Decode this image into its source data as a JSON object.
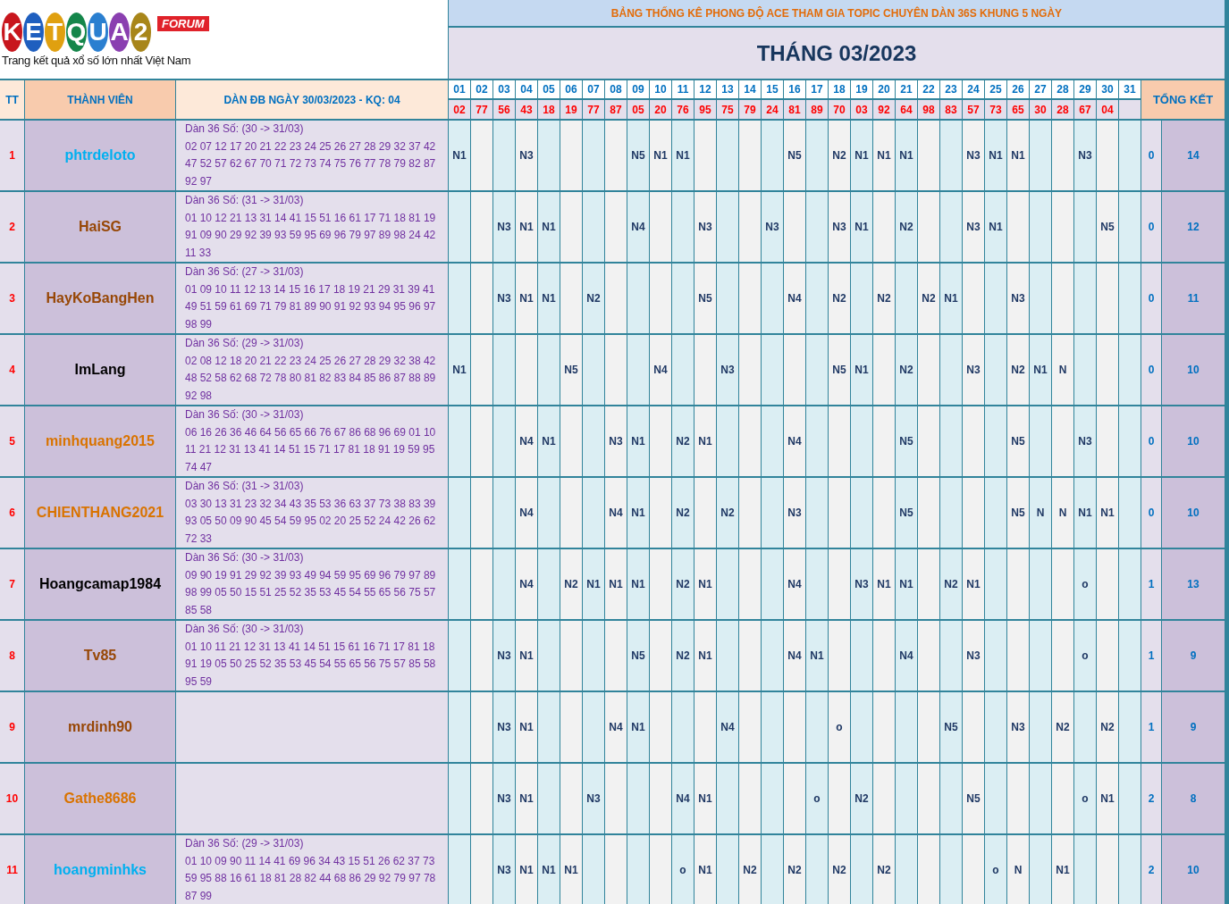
{
  "logo": {
    "letters": [
      {
        "char": "K",
        "color": "#c8161d"
      },
      {
        "char": "E",
        "color": "#1f5fbf"
      },
      {
        "char": "T",
        "color": "#e0a010"
      },
      {
        "char": "Q",
        "color": "#14864a"
      },
      {
        "char": "U",
        "color": "#2a7fd0"
      },
      {
        "char": "A",
        "color": "#8a3fb0"
      },
      {
        "char": "2",
        "color": "#a8861a"
      }
    ],
    "tag": "FORUM",
    "tagline": "Trang kết quả xổ số lớn nhất Việt Nam"
  },
  "banner": "BẢNG THỐNG KÊ PHONG ĐỘ ACE THAM GIA TOPIC CHUYÊN DÀN 36S KHUNG 5 NGÀY",
  "title": "THÁNG 03/2023",
  "columns": {
    "index": "TT",
    "member": "THÀNH VIÊN",
    "set": "DÀN ĐB NGÀY 30/03/2023 - KQ: 04",
    "summary": "TỔNG KẾT"
  },
  "days": [
    {
      "day": "01",
      "result": "02"
    },
    {
      "day": "02",
      "result": "77"
    },
    {
      "day": "03",
      "result": "56"
    },
    {
      "day": "04",
      "result": "43"
    },
    {
      "day": "05",
      "result": "18"
    },
    {
      "day": "06",
      "result": "19"
    },
    {
      "day": "07",
      "result": "77"
    },
    {
      "day": "08",
      "result": "87"
    },
    {
      "day": "09",
      "result": "05"
    },
    {
      "day": "10",
      "result": "20"
    },
    {
      "day": "11",
      "result": "76"
    },
    {
      "day": "12",
      "result": "95"
    },
    {
      "day": "13",
      "result": "75"
    },
    {
      "day": "14",
      "result": "79"
    },
    {
      "day": "15",
      "result": "24"
    },
    {
      "day": "16",
      "result": "81"
    },
    {
      "day": "17",
      "result": "89"
    },
    {
      "day": "18",
      "result": "70"
    },
    {
      "day": "19",
      "result": "03"
    },
    {
      "day": "20",
      "result": "92"
    },
    {
      "day": "21",
      "result": "64"
    },
    {
      "day": "22",
      "result": "98"
    },
    {
      "day": "23",
      "result": "83"
    },
    {
      "day": "24",
      "result": "57"
    },
    {
      "day": "25",
      "result": "73"
    },
    {
      "day": "26",
      "result": "65"
    },
    {
      "day": "27",
      "result": "30"
    },
    {
      "day": "28",
      "result": "28"
    },
    {
      "day": "29",
      "result": "67"
    },
    {
      "day": "30",
      "result": "04"
    },
    {
      "day": "31"
    }
  ],
  "rows": [
    {
      "index": "1",
      "member": "phtrdeloto",
      "color": "#00b0f0",
      "set_header": "Dàn 36 Số: (30 -> 31/03)",
      "set_numbers": "02 07 12 17 20 21 22 23 24 25 26 27 28 29 32 37 42 47 52 57 62 67 70 71 72 73 74 75 76 77 78 79 82 87 92 97",
      "marks": {
        "d01": "N1",
        "d04": "N3",
        "d09": "N5",
        "d10": "N1",
        "d11": "N1",
        "d16": "N5",
        "d18": "N2",
        "d19": "N1",
        "d20": "N1",
        "d21": "N1",
        "d24": "N3",
        "d25": "N1",
        "d26": "N1",
        "d29": "N3"
      },
      "misses": "0",
      "hits": "14"
    },
    {
      "index": "2",
      "member": "HaiSG",
      "color": "#974706",
      "set_header": "Dàn 36 Số: (31 -> 31/03)",
      "set_numbers": "01 10 12 21 13 31 14 41 15 51 16 61 17 71 18 81 19 91 09 90 29 92 39 93 59 95 69 96 79 97 89 98 24 42 11 33",
      "marks": {
        "d03": "N3",
        "d04": "N1",
        "d05": "N1",
        "d09": "N4",
        "d12": "N3",
        "d15": "N3",
        "d18": "N3",
        "d19": "N1",
        "d21": "N2",
        "d24": "N3",
        "d25": "N1",
        "d30": "N5"
      },
      "misses": "0",
      "hits": "12"
    },
    {
      "index": "3",
      "member": "HayKoBangHen",
      "color": "#974706",
      "set_header": "Dàn 36 Số: (27 -> 31/03)",
      "set_numbers": "01 09 10 11 12 13 14 15 16 17 18 19 21 29 31 39 41 49 51 59 61 69 71 79 81 89 90 91 92 93 94 95 96 97 98 99",
      "marks": {
        "d03": "N3",
        "d04": "N1",
        "d05": "N1",
        "d07": "N2",
        "d12": "N5",
        "d16": "N4",
        "d18": "N2",
        "d20": "N2",
        "d22": "N2",
        "d23": "N1",
        "d26": "N3"
      },
      "misses": "0",
      "hits": "11"
    },
    {
      "index": "4",
      "member": "ImLang",
      "color": "#000000",
      "set_header": "Dàn 36 Số: (29 -> 31/03)",
      "set_numbers": "02 08 12 18 20 21 22 23 24 25 26 27 28 29 32 38 42 48 52 58 62 68 72 78 80 81 82 83 84 85 86 87 88 89 92 98",
      "marks": {
        "d01": "N1",
        "d06": "N5",
        "d10": "N4",
        "d13": "N3",
        "d18": "N5",
        "d19": "N1",
        "d21": "N2",
        "d24": "N3",
        "d26": "N2",
        "d27": "N1",
        "d28": "N"
      },
      "misses": "0",
      "hits": "10"
    },
    {
      "index": "5",
      "member": "minhquang2015",
      "color": "#d97300",
      "set_header": "Dàn 36 Số: (30 -> 31/03)",
      "set_numbers": "06 16 26 36 46 64 56 65 66 76 67 86 68 96 69 01 10 11 21 12 31 13 41 14 51 15 71 17 81 18 91 19 59 95 74 47",
      "marks": {
        "d04": "N4",
        "d05": "N1",
        "d08": "N3",
        "d09": "N1",
        "d11": "N2",
        "d12": "N1",
        "d16": "N4",
        "d21": "N5",
        "d26": "N5",
        "d29": "N3"
      },
      "misses": "0",
      "hits": "10"
    },
    {
      "index": "6",
      "member": "CHIENTHANG2021",
      "color": "#d97300",
      "set_header": "Dàn 36 Số: (31 -> 31/03)",
      "set_numbers": "03 30 13 31 23 32 34 43 35 53 36 63 37 73 38 83 39 93 05 50 09 90 45 54 59 95 02 20 25 52 24 42 26 62 72 33",
      "marks": {
        "d04": "N4",
        "d08": "N4",
        "d09": "N1",
        "d11": "N2",
        "d13": "N2",
        "d16": "N3",
        "d21": "N5",
        "d26": "N5",
        "d27": "N",
        "d28": "N",
        "d29": "N1",
        "d30": "N1"
      },
      "misses": "0",
      "hits": "10"
    },
    {
      "index": "7",
      "member": "Hoangcamap1984",
      "color": "#000000",
      "set_header": "Dàn 36 Số: (30 -> 31/03)",
      "set_numbers": "09 90 19 91 29 92 39 93 49 94 59 95 69 96 79 97 89 98 99 05 50 15 51 25 52 35 53 45 54 55 65 56 75 57 85 58",
      "marks": {
        "d04": "N4",
        "d06": "N2",
        "d07": "N1",
        "d08": "N1",
        "d09": "N1",
        "d11": "N2",
        "d12": "N1",
        "d16": "N4",
        "d19": "N3",
        "d20": "N1",
        "d21": "N1",
        "d23": "N2",
        "d24": "N1",
        "d29": "o"
      },
      "misses": "1",
      "hits": "13"
    },
    {
      "index": "8",
      "member": "Tv85",
      "color": "#974706",
      "set_header": "Dàn 36 Số: (30 -> 31/03)",
      "set_numbers": "01 10 11 21 12 31 13 41 14 51 15 61 16 71 17 81 18 91 19 05 50 25 52 35 53 45 54 55 65 56 75 57 85 58 95 59",
      "marks": {
        "d03": "N3",
        "d04": "N1",
        "d09": "N5",
        "d11": "N2",
        "d12": "N1",
        "d16": "N4",
        "d17": "N1",
        "d21": "N4",
        "d24": "N3",
        "d29": "o"
      },
      "misses": "1",
      "hits": "9"
    },
    {
      "index": "9",
      "member": "mrdinh90",
      "color": "#974706",
      "marks": {
        "d03": "N3",
        "d04": "N1",
        "d08": "N4",
        "d09": "N1",
        "d13": "N4",
        "d18": "o",
        "d23": "N5",
        "d26": "N3",
        "d28": "N2",
        "d30": "N2"
      },
      "misses": "1",
      "hits": "9"
    },
    {
      "index": "10",
      "member": "Gathe8686",
      "color": "#d97300",
      "marks": {
        "d03": "N3",
        "d04": "N1",
        "d07": "N3",
        "d11": "N4",
        "d12": "N1",
        "d17": "o",
        "d19": "N2",
        "d24": "N5",
        "d29": "o",
        "d30": "N1"
      },
      "misses": "2",
      "hits": "8"
    },
    {
      "index": "11",
      "member": "hoangminhks",
      "color": "#00b0f0",
      "set_header": "Dàn 36 Số: (29 -> 31/03)",
      "set_numbers": "01 10 09 90 11 14 41 69 96 34 43 15 51 26 62 37 73 59 95 88 16 61 18 81 28 82 44 68 86 29 92 79 97 78 87 99",
      "marks": {
        "d03": "N3",
        "d04": "N1",
        "d05": "N1",
        "d06": "N1",
        "d11": "o",
        "d12": "N1",
        "d14": "N2",
        "d16": "N2",
        "d18": "N2",
        "d20": "N2",
        "d25": "o",
        "d26": "N",
        "d28": "N1"
      },
      "misses": "2",
      "hits": "10"
    }
  ]
}
